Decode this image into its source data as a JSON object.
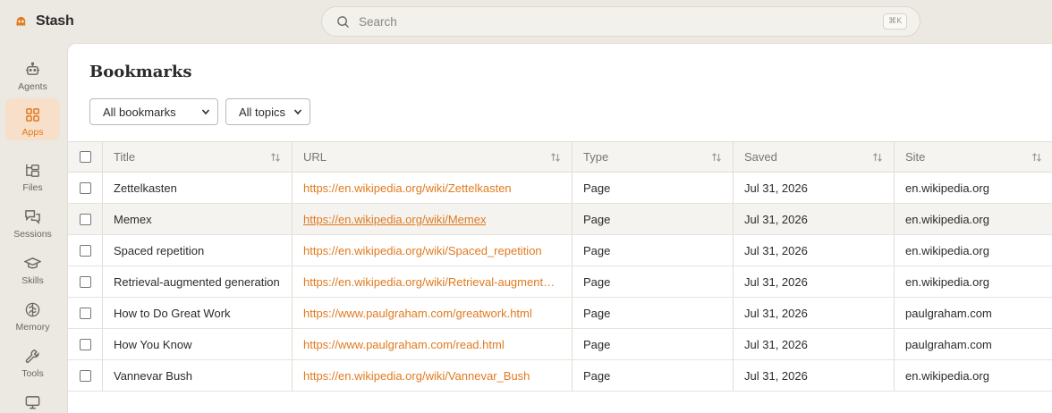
{
  "app": {
    "name": "Stash",
    "accent": "#e07a1f"
  },
  "search": {
    "placeholder": "Search",
    "shortcut": "⌘K"
  },
  "sidebar": {
    "items": [
      {
        "label": "Agents",
        "icon": "robot-icon",
        "active": false
      },
      {
        "label": "Apps",
        "icon": "grid-icon",
        "active": true
      },
      {
        "label": "Files",
        "icon": "files-icon",
        "active": false
      },
      {
        "label": "Sessions",
        "icon": "chat-icon",
        "active": false
      },
      {
        "label": "Skills",
        "icon": "graduation-cap-icon",
        "active": false
      },
      {
        "label": "Memory",
        "icon": "brain-icon",
        "active": false
      },
      {
        "label": "Tools",
        "icon": "wrench-icon",
        "active": false
      },
      {
        "label": "",
        "icon": "monitor-icon",
        "active": false
      }
    ]
  },
  "page": {
    "title": "Bookmarks",
    "filters": {
      "bookmarks": "All bookmarks",
      "topics": "All topics"
    }
  },
  "table": {
    "columns": [
      "Title",
      "URL",
      "Type",
      "Saved",
      "Site"
    ],
    "rows": [
      {
        "title": "Zettelkasten",
        "url": "https://en.wikipedia.org/wiki/Zettelkasten",
        "type": "Page",
        "saved": "Jul 31, 2026",
        "site": "en.wikipedia.org"
      },
      {
        "title": "Memex",
        "url": "https://en.wikipedia.org/wiki/Memex",
        "type": "Page",
        "saved": "Jul 31, 2026",
        "site": "en.wikipedia.org"
      },
      {
        "title": "Spaced repetition",
        "url": "https://en.wikipedia.org/wiki/Spaced_repetition",
        "type": "Page",
        "saved": "Jul 31, 2026",
        "site": "en.wikipedia.org"
      },
      {
        "title": "Retrieval-augmented generation",
        "url": "https://en.wikipedia.org/wiki/Retrieval-augmented_generation",
        "type": "Page",
        "saved": "Jul 31, 2026",
        "site": "en.wikipedia.org"
      },
      {
        "title": "How to Do Great Work",
        "url": "https://www.paulgraham.com/greatwork.html",
        "type": "Page",
        "saved": "Jul 31, 2026",
        "site": "paulgraham.com"
      },
      {
        "title": "How You Know",
        "url": "https://www.paulgraham.com/read.html",
        "type": "Page",
        "saved": "Jul 31, 2026",
        "site": "paulgraham.com"
      },
      {
        "title": "Vannevar Bush",
        "url": "https://en.wikipedia.org/wiki/Vannevar_Bush",
        "type": "Page",
        "saved": "Jul 31, 2026",
        "site": "en.wikipedia.org"
      }
    ]
  }
}
